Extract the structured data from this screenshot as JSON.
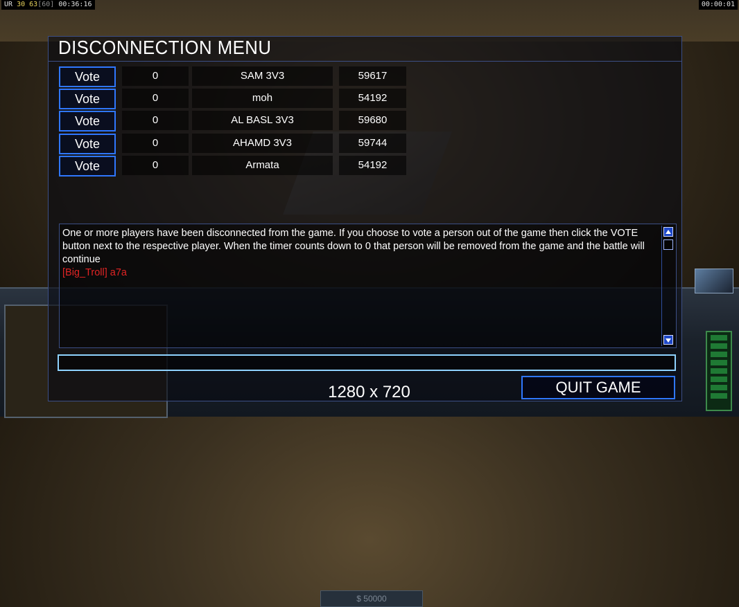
{
  "hud": {
    "top_left": {
      "label": "UR",
      "value1": "30",
      "value2": "63",
      "value3": "[60]",
      "timer": "00:36:16"
    },
    "top_right_timer": "00:00:01",
    "money": "$ 50000"
  },
  "dialog": {
    "title": "DISCONNECTION MENU",
    "vote_label": "Vote",
    "players": [
      {
        "votes": "0",
        "name": "SAM 3V3",
        "ping": "59617"
      },
      {
        "votes": "0",
        "name": "moh",
        "ping": "54192"
      },
      {
        "votes": "0",
        "name": "AL BASL 3V3",
        "ping": "59680"
      },
      {
        "votes": "0",
        "name": "AHAMD 3V3",
        "ping": "59744"
      },
      {
        "votes": "0",
        "name": "Armata",
        "ping": "54192"
      }
    ],
    "message": "One or more players have been disconnected from the game. If you choose to vote a person out of the game then click the VOTE button next to the respective player. When the timer counts down to 0 that person will be removed from the game and the battle will continue",
    "chat_line": "[Big_Troll] a7a",
    "chat_input_value": "",
    "quit_label": "QUIT GAME"
  },
  "resolution_label": "1280 x 720",
  "colors": {
    "accent_blue": "#2f77ff",
    "chat_red": "#e22424",
    "input_border": "#8fd3ff"
  }
}
